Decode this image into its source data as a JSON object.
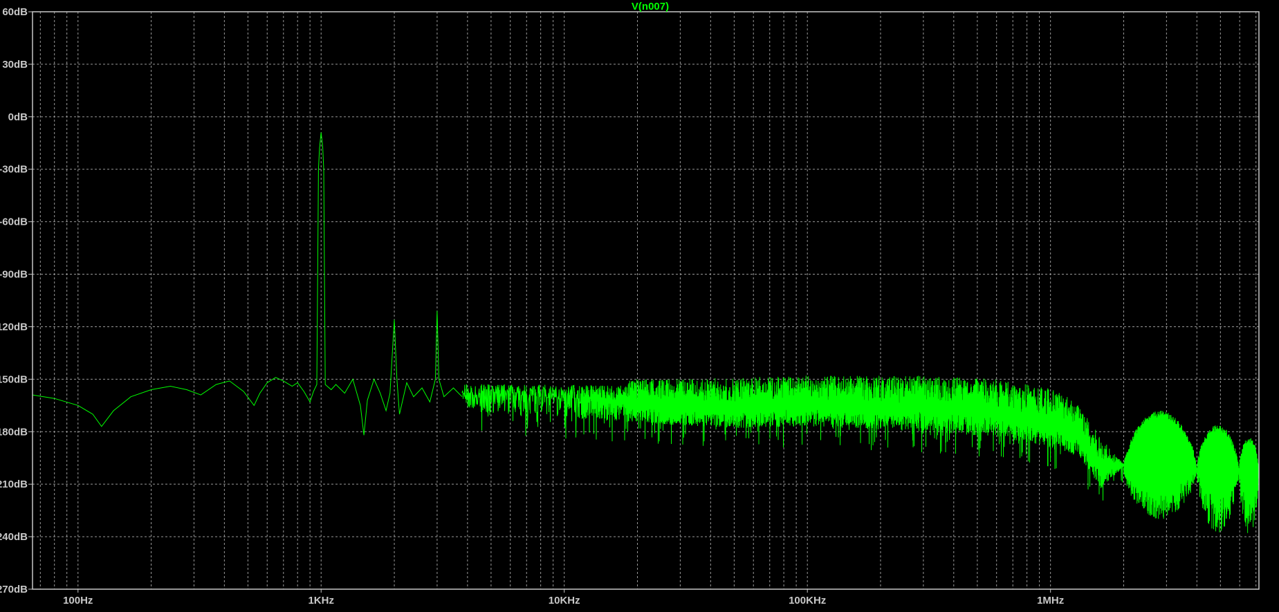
{
  "chart_data": {
    "type": "line",
    "title": "V(n007)",
    "xlabel": "",
    "ylabel": "",
    "x_scale": "log",
    "xlim": [
      65,
      7200000
    ],
    "ylim": [
      -270,
      60
    ],
    "grid": true,
    "x_ticks": [
      {
        "value": 100,
        "label": "100Hz"
      },
      {
        "value": 1000,
        "label": "1KHz"
      },
      {
        "value": 10000,
        "label": "10KHz"
      },
      {
        "value": 100000,
        "label": "100KHz"
      },
      {
        "value": 1000000,
        "label": "1MHz"
      }
    ],
    "y_ticks": [
      {
        "value": 60,
        "label": "60dB"
      },
      {
        "value": 30,
        "label": "30dB"
      },
      {
        "value": 0,
        "label": "0dB"
      },
      {
        "value": -30,
        "label": "-30dB"
      },
      {
        "value": -60,
        "label": "-60dB"
      },
      {
        "value": -90,
        "label": "-90dB"
      },
      {
        "value": -120,
        "label": "-120dB"
      },
      {
        "value": -150,
        "label": "-150dB"
      },
      {
        "value": -180,
        "label": "-180dB"
      },
      {
        "value": -210,
        "label": "-210dB"
      },
      {
        "value": -240,
        "label": "-240dB"
      },
      {
        "value": -270,
        "label": "-270dB"
      }
    ],
    "series": [
      {
        "name": "V(n007)",
        "color": "#00ff00",
        "points": [
          [
            65,
            -159
          ],
          [
            80,
            -161
          ],
          [
            100,
            -165
          ],
          [
            115,
            -170
          ],
          [
            125,
            -177
          ],
          [
            140,
            -168
          ],
          [
            165,
            -160
          ],
          [
            200,
            -156
          ],
          [
            240,
            -154
          ],
          [
            280,
            -156
          ],
          [
            320,
            -159
          ],
          [
            370,
            -153
          ],
          [
            420,
            -151
          ],
          [
            480,
            -157
          ],
          [
            530,
            -165
          ],
          [
            560,
            -158
          ],
          [
            600,
            -152
          ],
          [
            650,
            -149
          ],
          [
            700,
            -151
          ],
          [
            760,
            -154
          ],
          [
            800,
            -152
          ],
          [
            850,
            -157
          ],
          [
            900,
            -163
          ],
          [
            930,
            -157
          ],
          [
            960,
            -153
          ],
          [
            975,
            -30
          ],
          [
            985,
            -18
          ],
          [
            1000,
            -9
          ],
          [
            1015,
            -17
          ],
          [
            1025,
            -30
          ],
          [
            1040,
            -153
          ],
          [
            1100,
            -156
          ],
          [
            1150,
            -153
          ],
          [
            1250,
            -158
          ],
          [
            1350,
            -150
          ],
          [
            1450,
            -165
          ],
          [
            1500,
            -182
          ],
          [
            1550,
            -162
          ],
          [
            1650,
            -150
          ],
          [
            1750,
            -158
          ],
          [
            1850,
            -168
          ],
          [
            1920,
            -158
          ],
          [
            2000,
            -116
          ],
          [
            2050,
            -150
          ],
          [
            2100,
            -170
          ],
          [
            2250,
            -152
          ],
          [
            2400,
            -160
          ],
          [
            2600,
            -155
          ],
          [
            2800,
            -163
          ],
          [
            2950,
            -150
          ],
          [
            3000,
            -111
          ],
          [
            3050,
            -150
          ],
          [
            3200,
            -160
          ],
          [
            3500,
            -155
          ],
          [
            3800,
            -160
          ]
        ],
        "noise_envelope": [
          {
            "f": 3800,
            "upper": -150,
            "lower": -168
          },
          {
            "f": 10000,
            "upper": -150,
            "lower": -172
          },
          {
            "f": 20000,
            "upper": -150,
            "lower": -175
          },
          {
            "f": 50000,
            "upper": -149,
            "lower": -178
          },
          {
            "f": 100000,
            "upper": -148,
            "lower": -177
          },
          {
            "f": 300000,
            "upper": -148,
            "lower": -180
          },
          {
            "f": 600000,
            "upper": -150,
            "lower": -183
          },
          {
            "f": 1000000,
            "upper": -155,
            "lower": -189
          },
          {
            "f": 1300000,
            "upper": -163,
            "lower": -194
          },
          {
            "f": 1600000,
            "upper": -183,
            "lower": -213
          },
          {
            "f": 2000000,
            "upper": -198,
            "lower": -200
          }
        ],
        "lobes": [
          {
            "f_start": 2000000,
            "f_peak": 3000000,
            "f_end": 4000000,
            "peak": -168,
            "trough": -200,
            "floor": -230
          },
          {
            "f_start": 4000000,
            "f_peak": 4950000,
            "f_end": 5950000,
            "peak": -176,
            "trough": -200,
            "floor": -238
          },
          {
            "f_start": 5950000,
            "f_peak": 6600000,
            "f_end": 7200000,
            "peak": -183,
            "trough": -200,
            "floor": -240
          }
        ]
      }
    ]
  },
  "colors": {
    "background": "#000000",
    "trace": "#00ff00",
    "grid": "#9a9a9a",
    "frame": "#c8c8c8",
    "tick_text": "#c8c8c8",
    "title_text": "#00ff00"
  }
}
